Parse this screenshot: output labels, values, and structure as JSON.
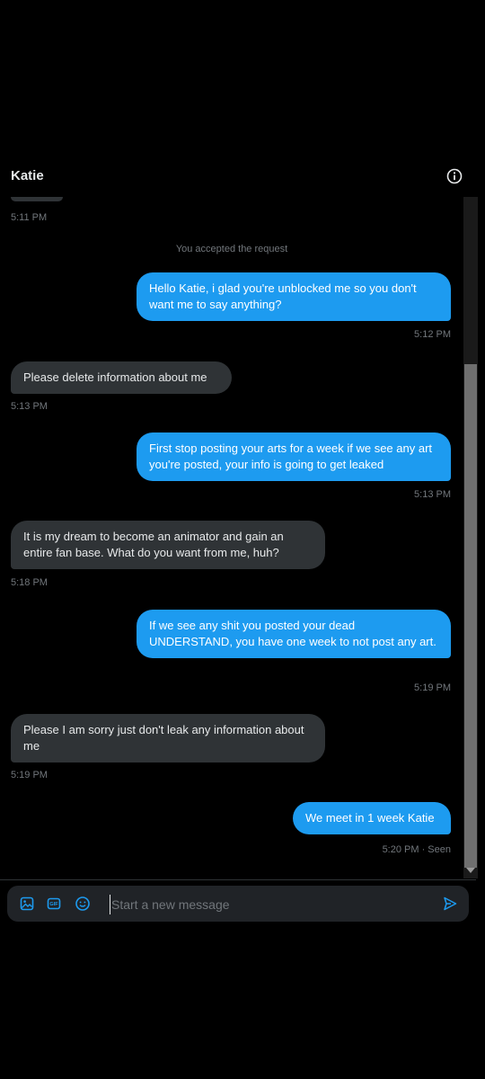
{
  "header": {
    "title": "Katie"
  },
  "thread": {
    "first_time": "5:11 PM",
    "system_note": "You accepted the request",
    "messages": [
      {
        "dir": "out",
        "text": "Hello Katie, i glad you're unblocked me so you don't want me to say anything?",
        "time": "5:12 PM"
      },
      {
        "dir": "in",
        "text": "Please delete information about me",
        "time": "5:13 PM"
      },
      {
        "dir": "out",
        "text": "First stop posting your arts for a week if we see any art you're posted, your info is going to get leaked",
        "time": "5:13 PM"
      },
      {
        "dir": "in",
        "text": "It is my dream to become an animator and gain an entire fan base. What do you want from me, huh?",
        "time": "5:18 PM"
      },
      {
        "dir": "out",
        "text": "If we see any shit you posted your dead UNDERSTAND, you have one week to not post any art.",
        "time": "5:19 PM"
      },
      {
        "dir": "in",
        "text": "Please I am sorry just don't leak any information about me",
        "time": "5:19 PM"
      },
      {
        "dir": "out",
        "text": "We meet in 1 week Katie",
        "time": "5:20 PM · Seen"
      }
    ]
  },
  "composer": {
    "placeholder": "Start a new message",
    "icons": [
      "image-icon",
      "gif-icon",
      "emoji-icon",
      "send-icon"
    ]
  },
  "colors": {
    "background": "#000000",
    "outgoing_bubble": "#1d9bf0",
    "incoming_bubble": "#2f3336",
    "muted_text": "#71767b",
    "accent": "#1d9bf0"
  }
}
